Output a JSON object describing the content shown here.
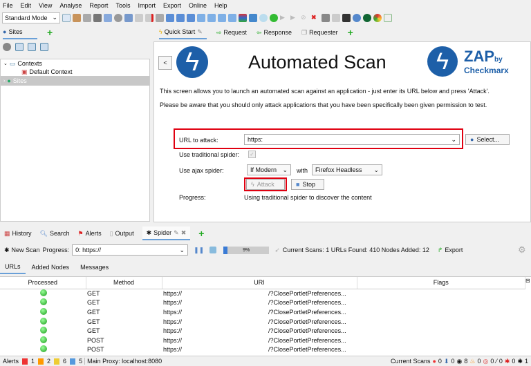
{
  "menu": [
    "File",
    "Edit",
    "View",
    "Analyse",
    "Report",
    "Tools",
    "Import",
    "Export",
    "Online",
    "Help"
  ],
  "toolbar": {
    "mode": "Standard Mode"
  },
  "left_tabs": {
    "sites": "Sites"
  },
  "tree": {
    "contexts": "Contexts",
    "default_context": "Default Context",
    "sites": "Sites"
  },
  "work_tabs": [
    "Quick Start",
    "Request",
    "Response",
    "Requester"
  ],
  "quickstart": {
    "back": "<",
    "title": "Automated Scan",
    "logo_zap": "ZAP",
    "logo_by": "by",
    "logo_brand": "Checkmarx",
    "intro1": "This screen allows you to launch an automated scan against  an application - just enter its URL below and press 'Attack'.",
    "intro2": "Please be aware that you should only attack applications that you have been specifically been given permission to test.",
    "url_label": "URL to attack:",
    "url_value": "https:",
    "select_label": "Select...",
    "trad_label": "Use traditional spider:",
    "ajax_label": "Use ajax spider:",
    "ajax_when": "If Modern",
    "with": "with",
    "browser": "Firefox Headless",
    "attack": "Attack",
    "stop": "Stop",
    "progress_label": "Progress:",
    "progress_value": "Using traditional spider to discover the content"
  },
  "bottom_tabs": [
    "History",
    "Search",
    "Alerts",
    "Output",
    "Spider"
  ],
  "spider": {
    "new_scan": "New Scan",
    "progress_label": "Progress:",
    "progress_select": "0: https://",
    "percent": 9,
    "percent_label": "9%",
    "status": "Current Scans: 1 URLs Found: 410 Nodes Added: 12",
    "export": "Export"
  },
  "sub_tabs": [
    "URLs",
    "Added Nodes",
    "Messages"
  ],
  "table": {
    "headers": [
      "Processed",
      "Method",
      "URI",
      "Flags"
    ],
    "rows": [
      {
        "method": "GET",
        "uri": "https://",
        "path": "/?ClosePortletPreferences..."
      },
      {
        "method": "GET",
        "uri": "https://",
        "path": "/?ClosePortletPreferences..."
      },
      {
        "method": "GET",
        "uri": "https://",
        "path": "/?ClosePortletPreferences..."
      },
      {
        "method": "GET",
        "uri": "https://",
        "path": "/?ClosePortletPreferences..."
      },
      {
        "method": "GET",
        "uri": "https://",
        "path": "/?ClosePortletPreferences..."
      },
      {
        "method": "POST",
        "uri": "https://",
        "path": "/?ClosePortletPreferences..."
      },
      {
        "method": "POST",
        "uri": "https://",
        "path": "/?ClosePortletPreferences..."
      }
    ]
  },
  "statusbar": {
    "alerts": "Alerts",
    "high": "1",
    "medium": "2",
    "low": "6",
    "info": "5",
    "proxy": "Main Proxy: localhost:8080",
    "current_scans": "Current Scans",
    "counts": [
      "0",
      "0",
      "8",
      "0",
      "0",
      "0",
      "0",
      "1"
    ]
  }
}
